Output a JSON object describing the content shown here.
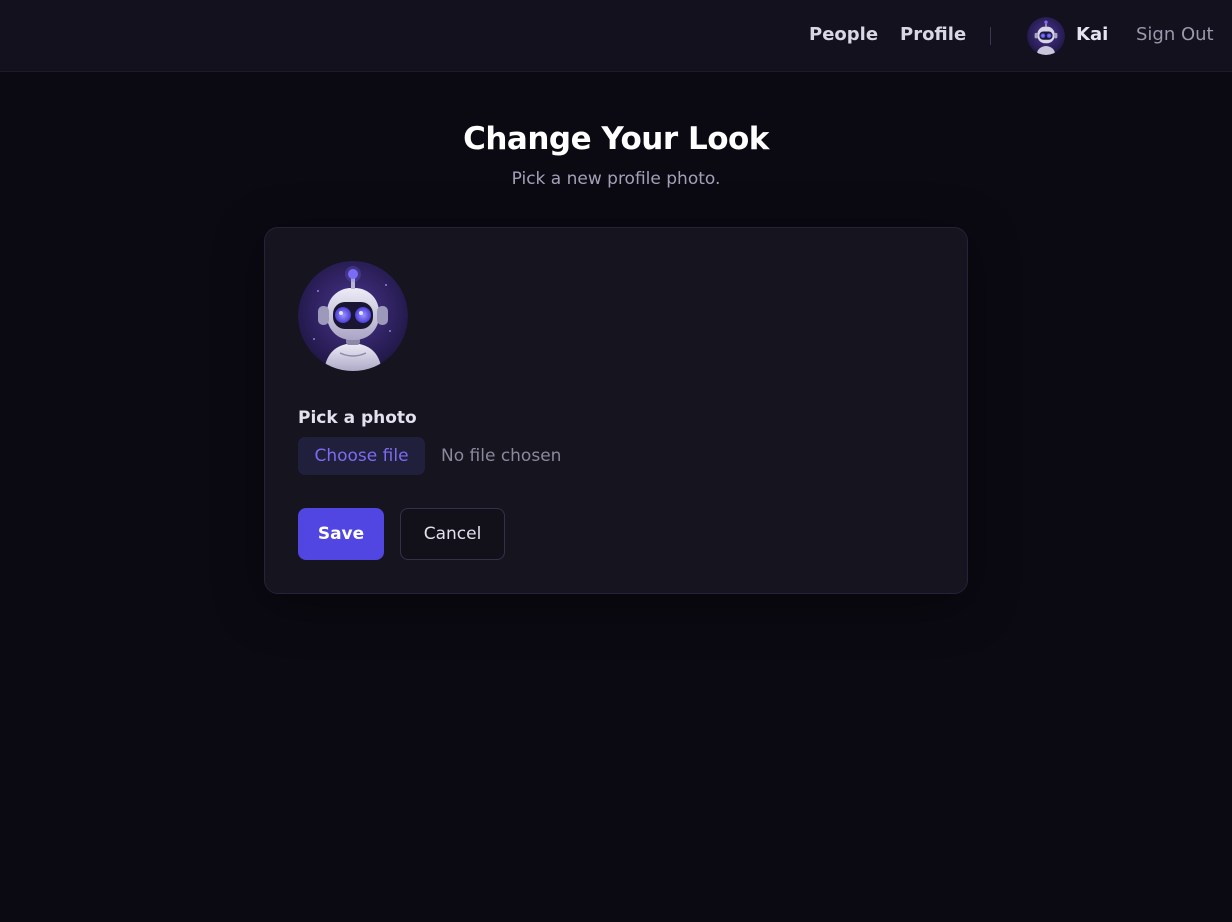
{
  "nav": {
    "links": [
      {
        "label": "People"
      },
      {
        "label": "Profile"
      }
    ],
    "user": {
      "name": "Kai",
      "avatar_icon": "robot-avatar-icon"
    },
    "sign_out_label": "Sign Out"
  },
  "page": {
    "title": "Change Your Look",
    "subtitle": "Pick a new profile photo."
  },
  "form": {
    "preview_icon": "robot-avatar-icon",
    "field_label": "Pick a photo",
    "choose_file_label": "Choose file",
    "file_status": "No file chosen",
    "save_label": "Save",
    "cancel_label": "Cancel"
  },
  "colors": {
    "background": "#0b0a13",
    "topbar": "#12111d",
    "card": "#15141f",
    "accent": "#5146e2",
    "choose_file_text": "#7b6cf2",
    "avatar_bg": "#3a2a6e",
    "robot_eyes": "#6a5cf0"
  }
}
